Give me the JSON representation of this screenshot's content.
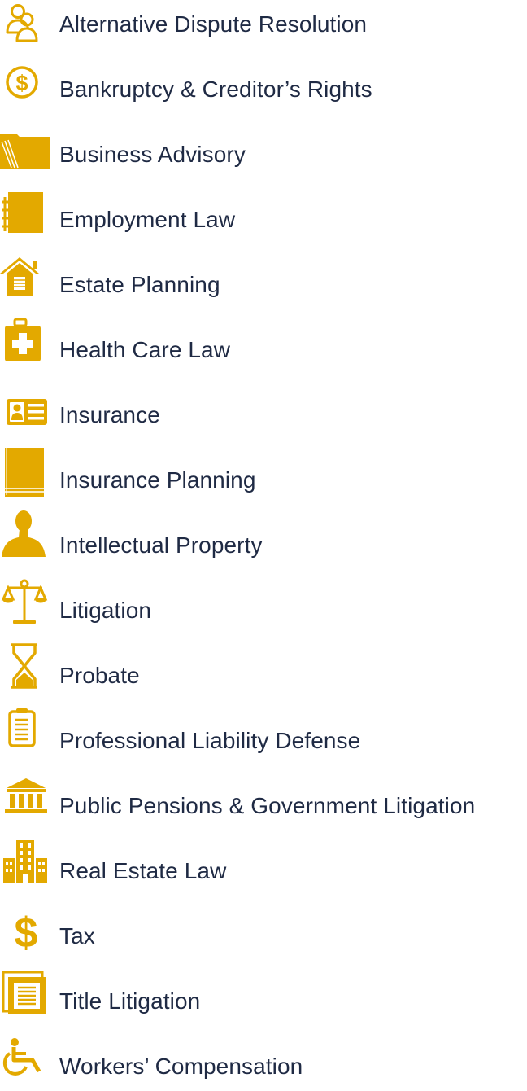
{
  "accent_color": "#e3a900",
  "text_color": "#1f2a44",
  "practice_areas": [
    {
      "label": "Alternative Dispute Resolution",
      "icon": "people-icon"
    },
    {
      "label": "Bankruptcy & Creditor’s Rights",
      "icon": "dollar-circle-icon"
    },
    {
      "label": "Business Advisory",
      "icon": "folder-icon"
    },
    {
      "label": "Employment Law",
      "icon": "notebook-icon"
    },
    {
      "label": "Estate Planning",
      "icon": "house-icon"
    },
    {
      "label": "Health Care Law",
      "icon": "medical-kit-icon"
    },
    {
      "label": "Insurance",
      "icon": "id-card-icon"
    },
    {
      "label": "Insurance Planning",
      "icon": "book-icon"
    },
    {
      "label": "Intellectual Property",
      "icon": "person-icon"
    },
    {
      "label": "Litigation",
      "icon": "scales-icon"
    },
    {
      "label": "Probate",
      "icon": "hourglass-icon"
    },
    {
      "label": "Professional Liability Defense",
      "icon": "clipboard-icon"
    },
    {
      "label": "Public Pensions & Government Litigation",
      "icon": "government-building-icon"
    },
    {
      "label": "Real Estate Law",
      "icon": "buildings-icon"
    },
    {
      "label": "Tax",
      "icon": "dollar-sign-icon"
    },
    {
      "label": "Title Litigation",
      "icon": "documents-icon"
    },
    {
      "label": "Workers’ Compensation",
      "icon": "wheelchair-icon"
    }
  ]
}
